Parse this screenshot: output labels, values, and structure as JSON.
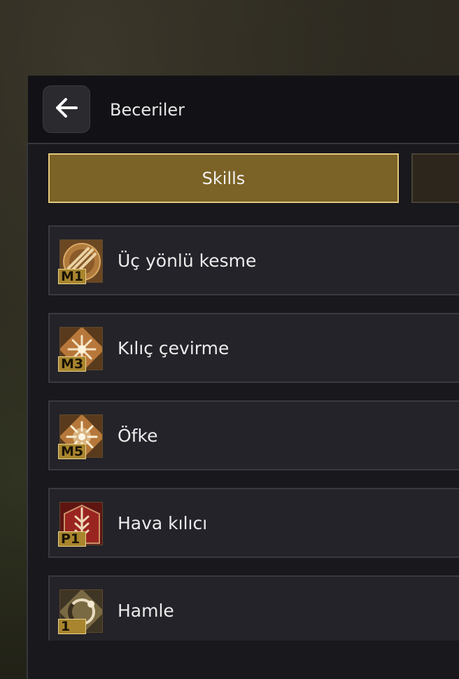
{
  "header": {
    "title": "Beceriler",
    "back_icon": "arrow-left-icon"
  },
  "tabs": [
    {
      "label": "Skills",
      "active": true
    },
    {
      "label": "",
      "active": false
    }
  ],
  "skills": [
    {
      "name": "Üç yönlü kesme",
      "key": "M1",
      "icon": "crossed-swords-icon"
    },
    {
      "name": "Kılıç çevirme",
      "key": "M3",
      "icon": "spinning-blade-icon"
    },
    {
      "name": "Öfke",
      "key": "M5",
      "icon": "rage-burst-icon"
    },
    {
      "name": "Hava kılıcı",
      "key": "P1",
      "icon": "air-sword-icon"
    },
    {
      "name": "Hamle",
      "key": "1",
      "icon": "charge-ring-icon"
    }
  ],
  "colors": {
    "accent": "#7b6226",
    "accent_border": "#e3c77d",
    "badge": "#a8852e"
  }
}
